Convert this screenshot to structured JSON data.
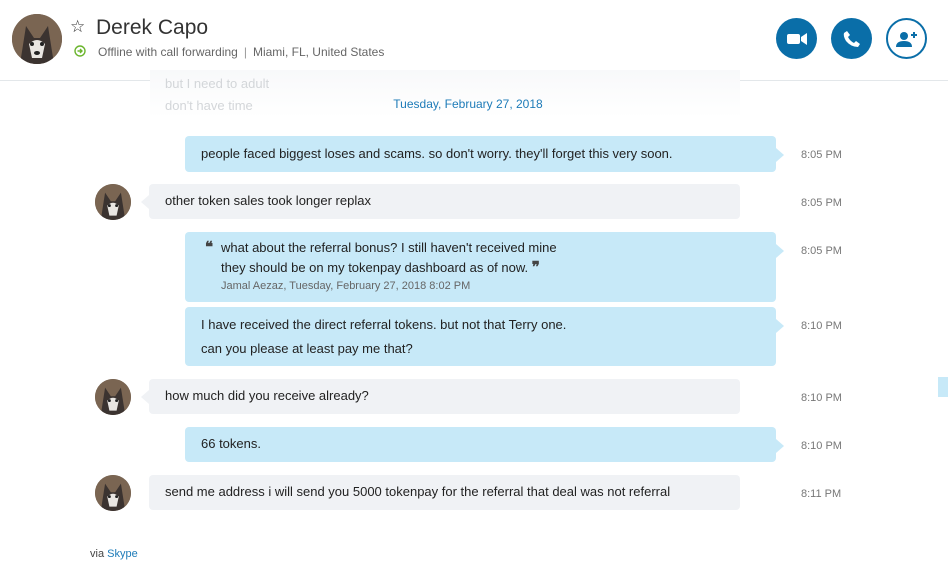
{
  "contact": {
    "name": "Derek Capo",
    "status": "Offline with call forwarding",
    "separator": "|",
    "location": "Miami, FL, United States",
    "star_icon": "star-outline-icon",
    "status_icon": "call-forwarding-icon"
  },
  "actions": {
    "video_icon": "video-call-icon",
    "call_icon": "phone-icon",
    "add_icon": "add-person-icon",
    "accent_color": "#0a6ea8"
  },
  "faded_previous": {
    "line1": "but I need to adult",
    "line2": "don't have time"
  },
  "date_separator": "Tuesday, February 27, 2018",
  "messages": [
    {
      "direction": "outgoing",
      "text": "people faced biggest loses and scams. so don't worry. they'll forget this very soon.",
      "time": "8:05 PM"
    },
    {
      "direction": "incoming",
      "text": "other token sales took longer replax",
      "time": "8:05 PM"
    },
    {
      "direction": "outgoing",
      "quote": {
        "open": "❝",
        "line1": "what about the referral bonus? I still haven't received mine",
        "line2": "they should be on my tokenpay dashboard as of now.",
        "close": "❞",
        "meta": "Jamal Aezaz, Tuesday, February 27, 2018 8:02 PM"
      },
      "time": "8:05 PM"
    },
    {
      "direction": "outgoing",
      "line1": "I have received the direct referral tokens. but not that Terry one.",
      "line2": "can you please at least pay me that?",
      "time": "8:10 PM"
    },
    {
      "direction": "incoming",
      "text": "how much did you receive already?",
      "time": "8:10 PM"
    },
    {
      "direction": "outgoing",
      "text": "66 tokens.",
      "time": "8:10 PM"
    },
    {
      "direction": "incoming",
      "text": "send me address i will send you 5000 tokenpay for the referral that deal was not referral",
      "time": "8:11 PM"
    }
  ],
  "footer": {
    "via": "via",
    "link": "Skype"
  },
  "colors": {
    "outgoing_bubble": "#c7e9f8",
    "incoming_bubble": "#f0f2f5",
    "link": "#1d7bb8"
  }
}
